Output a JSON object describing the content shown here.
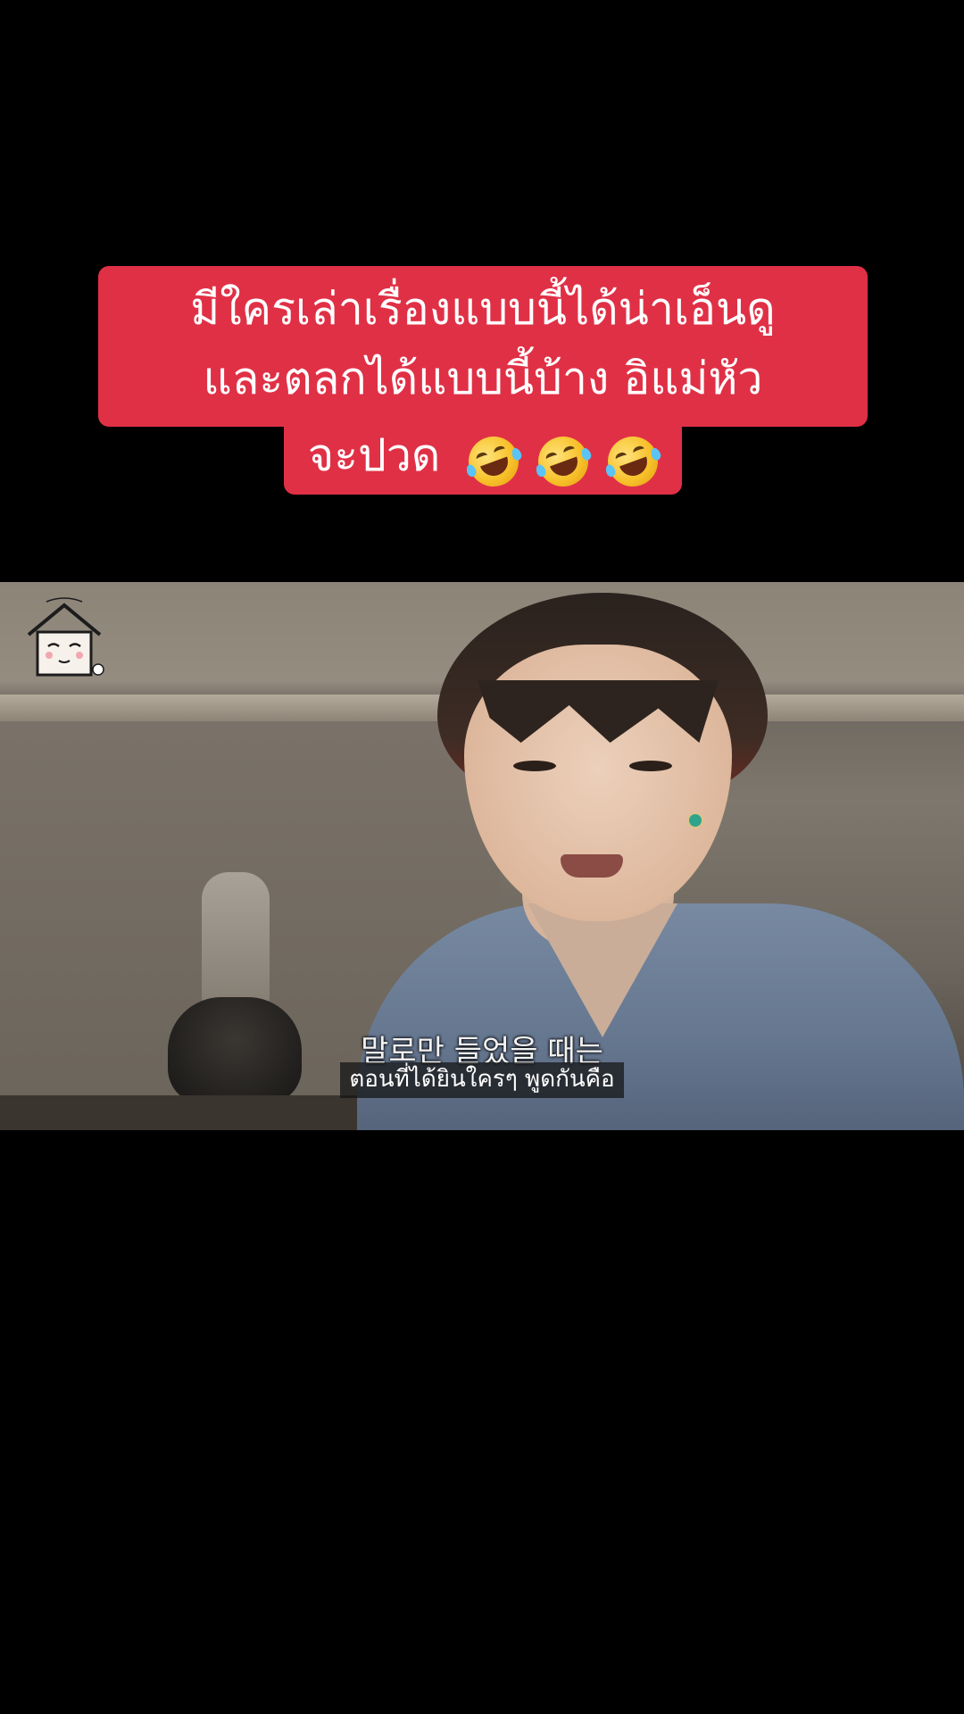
{
  "caption": {
    "line1": "มีใครเล่าเรื่องแบบนี้ได้น่าเอ็นดู",
    "line2": "และตลกได้แบบนี้บ้าง อิแม่หัว",
    "line3": "จะปวด",
    "emoji": "rolling-on-floor-laughing",
    "emoji_count": 3,
    "background_color": "#e03046",
    "text_color": "#ffffff"
  },
  "video": {
    "subtitle_korean": "말로만 들었을 때는",
    "subtitle_thai": "ตอนที่ได้ยินใครๆ พูดกันคือ",
    "watermark_icon": "house-face-logo"
  },
  "colors": {
    "page_background": "#000000"
  }
}
